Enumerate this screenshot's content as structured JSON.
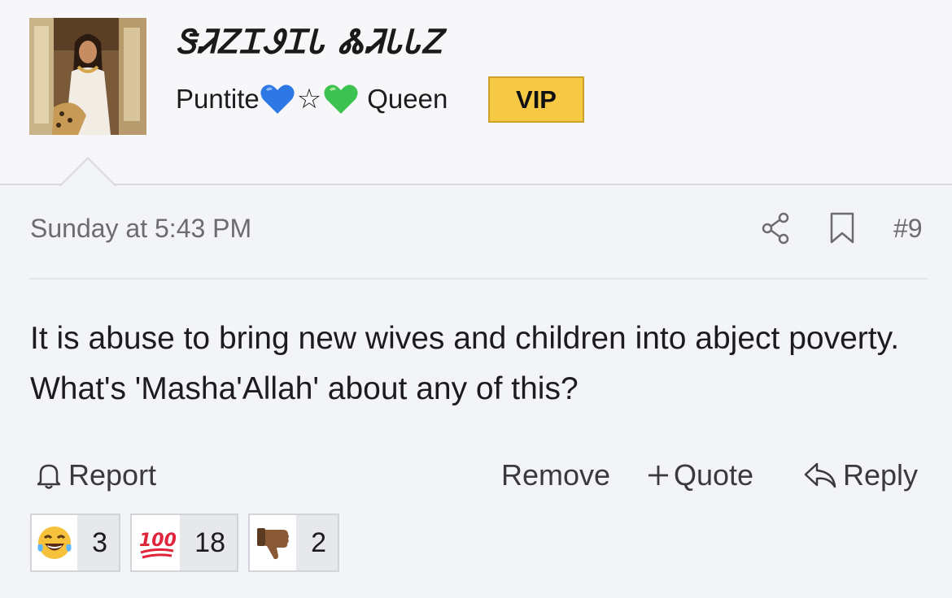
{
  "user": {
    "name": "ᏕᏘᏃᏆᏭᏆᏓ ᏜᏘᏓᏓᏃ",
    "title_prefix": "Puntite",
    "title_star": "☆",
    "title_suffix": "Queen",
    "badge": "VIP"
  },
  "post": {
    "date": "Sunday at 5:43 PM",
    "number": "#9",
    "body": "It is abuse to bring new wives and children into abject poverty. What's 'Masha'Allah' about any of this?"
  },
  "actions": {
    "report": "Report",
    "remove": "Remove",
    "quote": "Quote",
    "reply": "Reply"
  },
  "reactions": [
    {
      "icon": "laughing-tears-emoji",
      "count": "3"
    },
    {
      "icon": "hundred-points-emoji",
      "count": "18"
    },
    {
      "icon": "thumbs-down-emoji",
      "count": "2"
    }
  ],
  "colors": {
    "vip_badge": "#f6c945",
    "background": "#f3f4f8",
    "header_background": "#f7f7f9"
  }
}
